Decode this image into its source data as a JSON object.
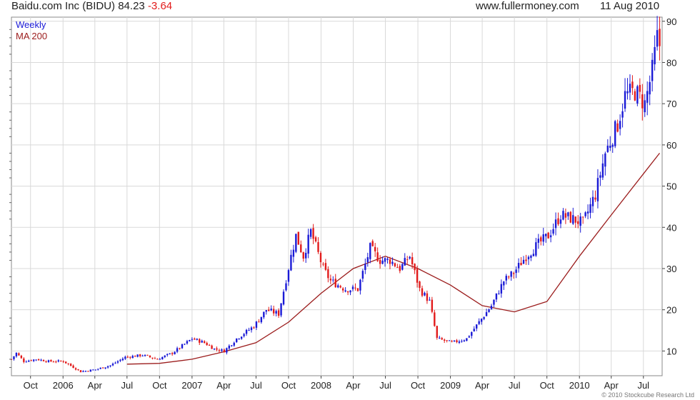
{
  "header": {
    "title": "Baidu.com Inc (BIDU)",
    "last_price": "84.23",
    "change": "-3.64",
    "source": "www.fullermoney.com",
    "date": "11 Aug 2010"
  },
  "legend": {
    "weekly": "Weekly",
    "ma": "MA 200"
  },
  "footer": {
    "copyright": "© 2010 Stockcube Research Ltd"
  },
  "colors": {
    "up": "#1a1ad6",
    "down": "#e21b1b",
    "ma": "#9b1c1c",
    "grid": "#d9d9d9",
    "axis": "#888888"
  },
  "chart_data": {
    "type": "candlestick",
    "interval": "weekly",
    "ylim": [
      4,
      91
    ],
    "grid": true,
    "y_ticks": [
      10,
      20,
      30,
      40,
      50,
      60,
      70,
      80,
      90
    ],
    "x_ticks": [
      {
        "label": "Oct",
        "date": "2005-10-01"
      },
      {
        "label": "2006",
        "date": "2006-01-01"
      },
      {
        "label": "Apr",
        "date": "2006-04-01"
      },
      {
        "label": "Jul",
        "date": "2006-07-01"
      },
      {
        "label": "Oct",
        "date": "2006-10-01"
      },
      {
        "label": "2007",
        "date": "2007-01-01"
      },
      {
        "label": "Apr",
        "date": "2007-04-01"
      },
      {
        "label": "Jul",
        "date": "2007-07-01"
      },
      {
        "label": "Oct",
        "date": "2007-10-01"
      },
      {
        "label": "2008",
        "date": "2008-01-01"
      },
      {
        "label": "Apr",
        "date": "2008-04-01"
      },
      {
        "label": "Jul",
        "date": "2008-07-01"
      },
      {
        "label": "Oct",
        "date": "2008-10-01"
      },
      {
        "label": "2009",
        "date": "2009-01-01"
      },
      {
        "label": "Apr",
        "date": "2009-04-01"
      },
      {
        "label": "Jul",
        "date": "2009-07-01"
      },
      {
        "label": "Oct",
        "date": "2009-10-01"
      },
      {
        "label": "2010",
        "date": "2010-01-01"
      },
      {
        "label": "Apr",
        "date": "2010-04-01"
      },
      {
        "label": "Jul",
        "date": "2010-07-01"
      }
    ],
    "x_range": [
      "2005-08-08",
      "2010-08-23"
    ],
    "price_path": [
      [
        "2005-08-08",
        8
      ],
      [
        "2005-08-22",
        9.5
      ],
      [
        "2005-09-12",
        7.5
      ],
      [
        "2005-10-17",
        8
      ],
      [
        "2005-11-21",
        7.5
      ],
      [
        "2006-01-02",
        7.5
      ],
      [
        "2006-02-20",
        5
      ],
      [
        "2006-04-03",
        5.5
      ],
      [
        "2006-05-15",
        6.5
      ],
      [
        "2006-06-26",
        8.5
      ],
      [
        "2006-08-14",
        9
      ],
      [
        "2006-09-25",
        8
      ],
      [
        "2006-11-06",
        9.5
      ],
      [
        "2007-01-01",
        13
      ],
      [
        "2007-02-05",
        12
      ],
      [
        "2007-03-05",
        10.5
      ],
      [
        "2007-04-02",
        10
      ],
      [
        "2007-05-07",
        13
      ],
      [
        "2007-06-25",
        16
      ],
      [
        "2007-07-30",
        20
      ],
      [
        "2007-09-03",
        19
      ],
      [
        "2007-10-08",
        33
      ],
      [
        "2007-10-22",
        38
      ],
      [
        "2007-11-12",
        33
      ],
      [
        "2007-12-03",
        39
      ],
      [
        "2008-01-07",
        30
      ],
      [
        "2008-01-28",
        27
      ],
      [
        "2008-03-10",
        25
      ],
      [
        "2008-04-14",
        25
      ],
      [
        "2008-05-19",
        35
      ],
      [
        "2008-06-16",
        32
      ],
      [
        "2008-07-14",
        32
      ],
      [
        "2008-08-11",
        30
      ],
      [
        "2008-09-08",
        33
      ],
      [
        "2008-10-06",
        25
      ],
      [
        "2008-11-03",
        22
      ],
      [
        "2008-11-24",
        13
      ],
      [
        "2009-01-05",
        12
      ],
      [
        "2009-02-16",
        13
      ],
      [
        "2009-03-23",
        17
      ],
      [
        "2009-04-27",
        21
      ],
      [
        "2009-06-01",
        27
      ],
      [
        "2009-06-29",
        29
      ],
      [
        "2009-08-03",
        33
      ],
      [
        "2009-09-07",
        36
      ],
      [
        "2009-10-05",
        38
      ],
      [
        "2009-11-09",
        43
      ],
      [
        "2009-12-14",
        42
      ],
      [
        "2010-01-11",
        41
      ],
      [
        "2010-02-15",
        48
      ],
      [
        "2010-03-15",
        58
      ],
      [
        "2010-04-19",
        65
      ],
      [
        "2010-05-10",
        72
      ],
      [
        "2010-06-07",
        73
      ],
      [
        "2010-07-05",
        70
      ],
      [
        "2010-07-26",
        78
      ],
      [
        "2010-08-09",
        86
      ],
      [
        "2010-08-16",
        84.23
      ]
    ],
    "ma_200": [
      [
        "2006-07-01",
        6.8
      ],
      [
        "2006-10-01",
        7.0
      ],
      [
        "2007-01-01",
        8.0
      ],
      [
        "2007-04-01",
        9.8
      ],
      [
        "2007-07-01",
        12
      ],
      [
        "2007-10-01",
        17
      ],
      [
        "2008-01-01",
        24
      ],
      [
        "2008-04-01",
        30
      ],
      [
        "2008-07-01",
        33
      ],
      [
        "2008-10-01",
        30
      ],
      [
        "2009-01-01",
        26
      ],
      [
        "2009-04-01",
        21
      ],
      [
        "2009-07-01",
        19.5
      ],
      [
        "2009-10-01",
        22
      ],
      [
        "2010-01-01",
        33
      ],
      [
        "2010-04-01",
        43
      ],
      [
        "2010-07-01",
        53
      ],
      [
        "2010-08-16",
        58
      ]
    ]
  }
}
